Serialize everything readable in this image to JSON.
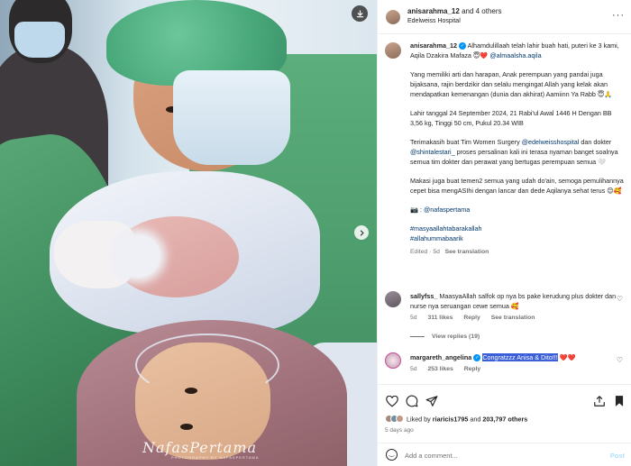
{
  "header": {
    "username": "anisarahma_12",
    "and_others": "and 4 others",
    "location": "Edelweiss Hospital"
  },
  "image": {
    "watermark": "NafasPertama",
    "watermark_sub": "PHOTOGRAPHY BY NAFASPERTAMA",
    "cap_brand": "edelweiss"
  },
  "caption": {
    "username": "anisarahma_12",
    "line1": "Alhamdulillaah telah lahir buah hati, puteri ke 3 kami, Aqila Dzakira Mafaza 😇❤️",
    "mention1": "@almaalsha.aqila",
    "para2": "Yang memiliki arti dan harapan, Anak perempuan yang pandai juga bijaksana, rajin berdzikir dan selalu mengingat Allah yang kelak akan mendapatkan kemenangan (dunia dan akhirat) Aamiinn Ya Rabb 😇🙏",
    "para3": "Lahir tanggal 24 September 2024, 21 Rabi'ul Awal 1446 H Dengan BB 3,56 kg, Tinggi 50 cm, Pukul 20.34 WIB",
    "para4_a": "Terimakasih buat Tim Women Surgery",
    "para4_mention": "@edelweisshospital",
    "para4_b": "dan dokter",
    "para4_mention2": "@shintalestari_",
    "para4_c": "proses persalinan kali ini terasa nyaman banget soalnya semua tim dokter dan perawat yang bertugas perempuan semua 🤍",
    "para5": "Makasi juga buat temen2 semua yang udah do'ain, semoga pemulihannya cepet bisa mengASIhi dengan lancar dan dede Aqilanya sehat terus 😊🥰",
    "camera_prefix": "📷 :",
    "camera_mention": "@nafaspertama",
    "hashtag1": "#masyaallahtabarakallah",
    "hashtag2": "#allahummabaarik",
    "edited": "Edited",
    "age": "5d",
    "see_translation": "See translation"
  },
  "comments": [
    {
      "username": "sallyfss_",
      "text": "MaasyaAllah salfok op nya bs pake kerudung plus dokter dan nurse nya seruangan cewe semua 🥰",
      "age": "5d",
      "likes": "311 likes",
      "reply": "Reply",
      "translate": "See translation"
    },
    {
      "username": "margareth_angelina",
      "text": "Congratzzz Anisa & Dito!!!",
      "emoji": "❤️❤️",
      "age": "5d",
      "likes": "253 likes",
      "reply": "Reply"
    }
  ],
  "view_replies": "View replies (19)",
  "likes_line": {
    "prefix": "Liked by",
    "user": "riaricis1795",
    "mid": "and",
    "count": "203,797 others"
  },
  "time_ago": "5 days ago",
  "add_comment": {
    "placeholder": "Add a comment...",
    "post": "Post"
  }
}
